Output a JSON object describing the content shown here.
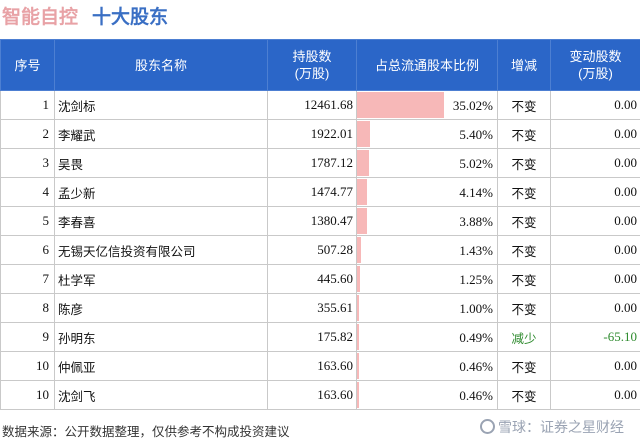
{
  "header": {
    "company": "智能自控",
    "subtitle": "十大股东"
  },
  "table": {
    "columns": [
      "序号",
      "股东名称",
      "持股数\n(万股)",
      "占总流通股本比例",
      "增减",
      "变动股数\n(万股)"
    ],
    "rows": [
      {
        "rank": "1",
        "name": "沈剑标",
        "shares": "12461.68",
        "ratio": 35.02,
        "ratio_label": "35.02%",
        "change": "不变",
        "delta": "0.00"
      },
      {
        "rank": "2",
        "name": "李耀武",
        "shares": "1922.01",
        "ratio": 5.4,
        "ratio_label": "5.40%",
        "change": "不变",
        "delta": "0.00"
      },
      {
        "rank": "3",
        "name": "吴畏",
        "shares": "1787.12",
        "ratio": 5.02,
        "ratio_label": "5.02%",
        "change": "不变",
        "delta": "0.00"
      },
      {
        "rank": "4",
        "name": "孟少新",
        "shares": "1474.77",
        "ratio": 4.14,
        "ratio_label": "4.14%",
        "change": "不变",
        "delta": "0.00"
      },
      {
        "rank": "5",
        "name": "李春喜",
        "shares": "1380.47",
        "ratio": 3.88,
        "ratio_label": "3.88%",
        "change": "不变",
        "delta": "0.00"
      },
      {
        "rank": "6",
        "name": "无锡天亿信投资有限公司",
        "shares": "507.28",
        "ratio": 1.43,
        "ratio_label": "1.43%",
        "change": "不变",
        "delta": "0.00"
      },
      {
        "rank": "7",
        "name": "杜学军",
        "shares": "445.60",
        "ratio": 1.25,
        "ratio_label": "1.25%",
        "change": "不变",
        "delta": "0.00"
      },
      {
        "rank": "8",
        "name": "陈彦",
        "shares": "355.61",
        "ratio": 1.0,
        "ratio_label": "1.00%",
        "change": "不变",
        "delta": "0.00"
      },
      {
        "rank": "9",
        "name": "孙明东",
        "shares": "175.82",
        "ratio": 0.49,
        "ratio_label": "0.49%",
        "change": "减少",
        "delta": "-65.10"
      },
      {
        "rank": "10",
        "name": "仲佩亚",
        "shares": "163.60",
        "ratio": 0.46,
        "ratio_label": "0.46%",
        "change": "不变",
        "delta": "0.00"
      },
      {
        "rank": "10",
        "name": "沈剑飞",
        "shares": "163.60",
        "ratio": 0.46,
        "ratio_label": "0.46%",
        "change": "不变",
        "delta": "0.00"
      }
    ]
  },
  "footer": {
    "source": "数据来源：公开数据整理，仅供参考不构成投资建议",
    "watermark": "雪球：证券之星财经"
  },
  "colors": {
    "header_bg": "#2b66c8",
    "bar": "#f7b8b8",
    "decrease": "#2e8b2e",
    "title_company": "#e8a2a6",
    "title_subtitle": "#3a6fc4"
  }
}
